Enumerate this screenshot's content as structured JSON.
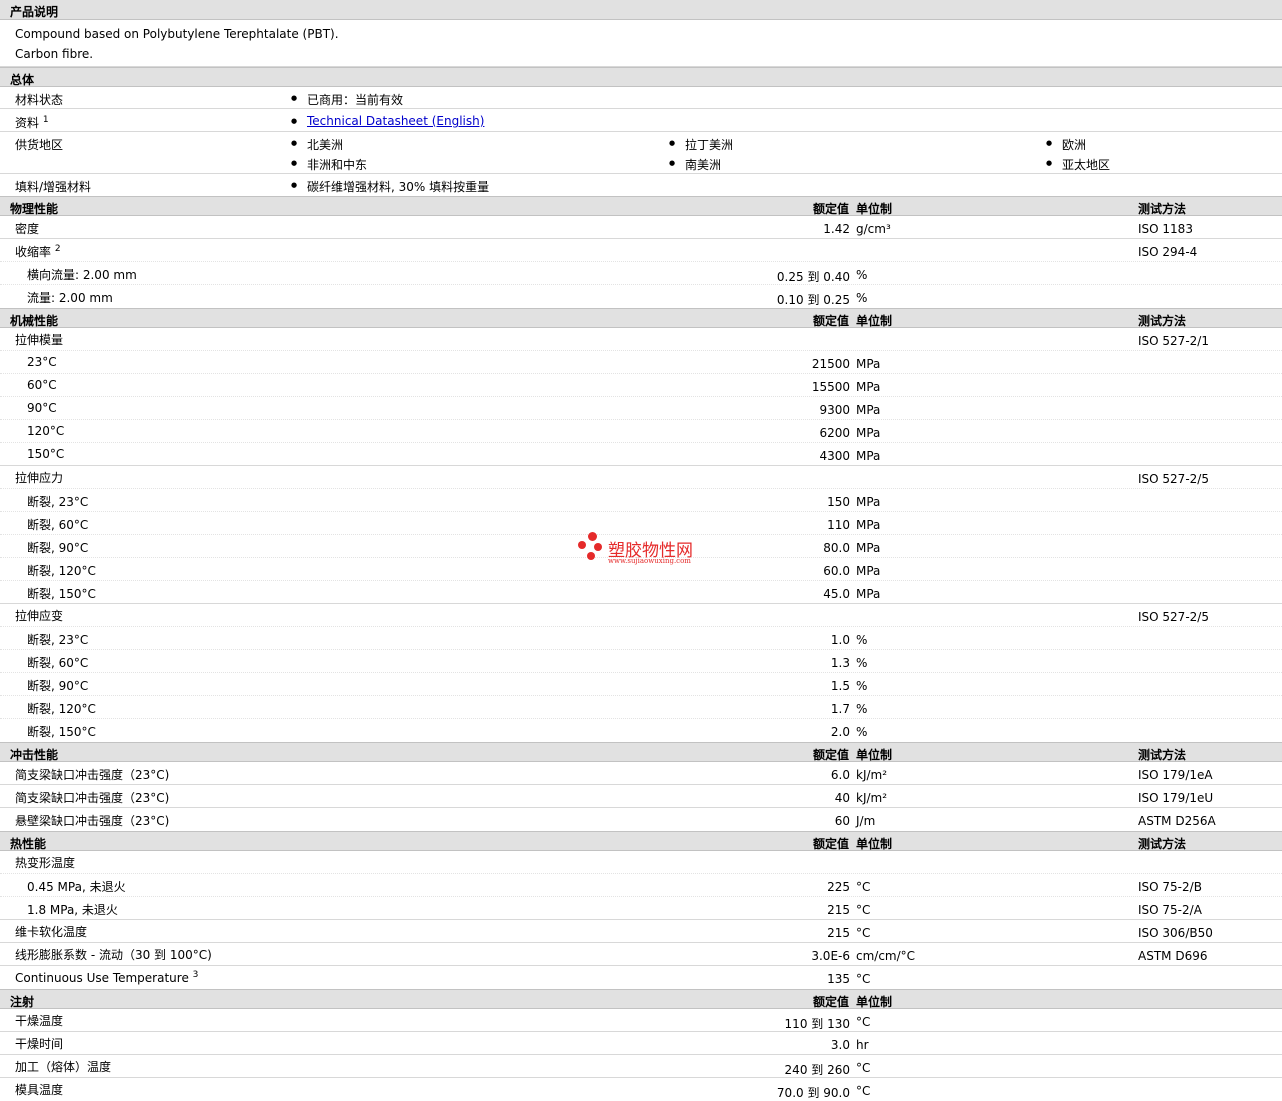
{
  "product": {
    "title": "产品说明",
    "lines": [
      "Compound based on Polybutylene Terephtalate (PBT).",
      "Carbon fibre."
    ]
  },
  "general": {
    "title": "总体",
    "status_label": "材料状态",
    "status_value": "已商用：当前有效",
    "doc_label": "资料",
    "doc_sup": "1",
    "doc_link": "Technical Datasheet (English)",
    "region_label": "供货地区",
    "regions": [
      "北美洲",
      "拉丁美洲",
      "欧洲",
      "非洲和中东",
      "南美洲",
      "亚太地区"
    ],
    "filler_label": "填料/增强材料",
    "filler_value": "碳纤维增强材料, 30% 填料按重量"
  },
  "headers": {
    "value": "额定值",
    "unit": "单位制",
    "method": "测试方法"
  },
  "physical": {
    "title": "物理性能",
    "density": {
      "label": "密度",
      "value": "1.42",
      "unit": "g/cm³",
      "method": "ISO 1183"
    },
    "shrink": {
      "label": "收缩率",
      "sup": "2",
      "method": "ISO 294-4"
    },
    "shrink_rows": [
      {
        "label": "横向流量: 2.00 mm",
        "value": "0.25 到  0.40",
        "unit": "%"
      },
      {
        "label": "流量: 2.00 mm",
        "value": "0.10 到  0.25",
        "unit": "%"
      }
    ]
  },
  "mechanical": {
    "title": "机械性能",
    "modulus": {
      "label": "拉伸模量",
      "method": "ISO 527-2/1"
    },
    "modulus_rows": [
      {
        "label": "23°C",
        "value": "21500",
        "unit": "MPa"
      },
      {
        "label": "60°C",
        "value": "15500",
        "unit": "MPa"
      },
      {
        "label": "90°C",
        "value": "9300",
        "unit": "MPa"
      },
      {
        "label": "120°C",
        "value": "6200",
        "unit": "MPa"
      },
      {
        "label": "150°C",
        "value": "4300",
        "unit": "MPa"
      }
    ],
    "stress": {
      "label": "拉伸应力",
      "method": "ISO 527-2/5"
    },
    "stress_rows": [
      {
        "label": "断裂, 23°C",
        "value": "150",
        "unit": "MPa"
      },
      {
        "label": "断裂, 60°C",
        "value": "110",
        "unit": "MPa"
      },
      {
        "label": "断裂, 90°C",
        "value": "80.0",
        "unit": "MPa"
      },
      {
        "label": "断裂, 120°C",
        "value": "60.0",
        "unit": "MPa"
      },
      {
        "label": "断裂, 150°C",
        "value": "45.0",
        "unit": "MPa"
      }
    ],
    "strain": {
      "label": "拉伸应变",
      "method": "ISO 527-2/5"
    },
    "strain_rows": [
      {
        "label": "断裂, 23°C",
        "value": "1.0",
        "unit": "%"
      },
      {
        "label": "断裂, 60°C",
        "value": "1.3",
        "unit": "%"
      },
      {
        "label": "断裂, 90°C",
        "value": "1.5",
        "unit": "%"
      },
      {
        "label": "断裂, 120°C",
        "value": "1.7",
        "unit": "%"
      },
      {
        "label": "断裂, 150°C",
        "value": "2.0",
        "unit": "%"
      }
    ]
  },
  "impact": {
    "title": "冲击性能",
    "rows": [
      {
        "label": "简支梁缺口冲击强度（23°C)",
        "value": "6.0",
        "unit": "kJ/m²",
        "method": "ISO 179/1eA"
      },
      {
        "label": "简支梁缺口冲击强度（23°C)",
        "value": "40",
        "unit": "kJ/m²",
        "method": "ISO 179/1eU"
      },
      {
        "label": "悬壁梁缺口冲击强度（23°C)",
        "value": "60",
        "unit": "J/m",
        "method": "ASTM D256A"
      }
    ]
  },
  "thermal": {
    "title": "热性能",
    "hdt": {
      "label": "热变形温度"
    },
    "hdt_rows": [
      {
        "label": "0.45 MPa, 未退火",
        "value": "225",
        "unit": "°C",
        "method": "ISO 75-2/B"
      },
      {
        "label": "1.8 MPa, 未退火",
        "value": "215",
        "unit": "°C",
        "method": "ISO 75-2/A"
      }
    ],
    "vicat": {
      "label": "维卡软化温度",
      "value": "215",
      "unit": "°C",
      "method": "ISO 306/B50"
    },
    "clte": {
      "label": "线形膨胀系数 - 流动（30 到  100°C)",
      "value": "3.0E-6",
      "unit": "cm/cm/°C",
      "method": "ASTM D696"
    },
    "cut": {
      "label": "Continuous Use Temperature",
      "sup": "3",
      "value": "135",
      "unit": "°C"
    }
  },
  "injection": {
    "title": "注射",
    "rows": [
      {
        "label": "干燥温度",
        "value": "110 到  130",
        "unit": "°C"
      },
      {
        "label": "干燥时间",
        "value": "3.0",
        "unit": "hr"
      },
      {
        "label": "加工（熔体）温度",
        "value": "240 到  260",
        "unit": "°C"
      },
      {
        "label": "模具温度",
        "value": "70.0 到  90.0",
        "unit": "°C"
      }
    ]
  },
  "watermark": {
    "name": "塑胶物性网",
    "url": "www.sujiaowuxing.com"
  }
}
